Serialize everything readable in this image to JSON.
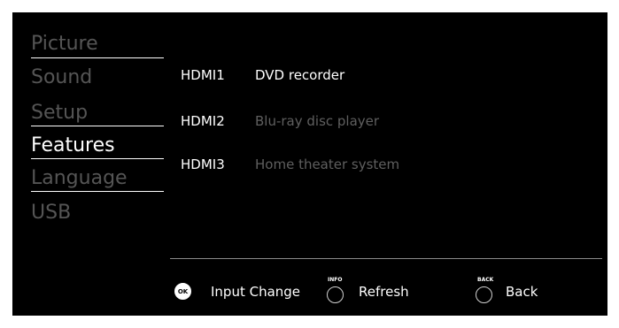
{
  "menu": {
    "items": [
      {
        "label": "Picture",
        "active": false
      },
      {
        "label": "Sound",
        "active": false
      },
      {
        "label": "Setup",
        "active": false
      },
      {
        "label": "Features",
        "active": true
      },
      {
        "label": "Language",
        "active": false
      },
      {
        "label": "USB",
        "active": false
      }
    ]
  },
  "inputs": {
    "rows": [
      {
        "port": "HDMI1",
        "device": "DVD recorder",
        "active": true
      },
      {
        "port": "HDMI2",
        "device": "Blu-ray disc player",
        "active": false
      },
      {
        "port": "HDMI3",
        "device": "Home theater system",
        "active": false
      }
    ]
  },
  "footer": {
    "ok_icon": "OK",
    "input_change_label": "Input Change",
    "info_tag": "INFO",
    "refresh_label": "Refresh",
    "back_tag": "BACK",
    "back_label": "Back"
  },
  "colors": {
    "background": "#000000",
    "active_text": "#ffffff",
    "inactive_text": "#555555"
  }
}
